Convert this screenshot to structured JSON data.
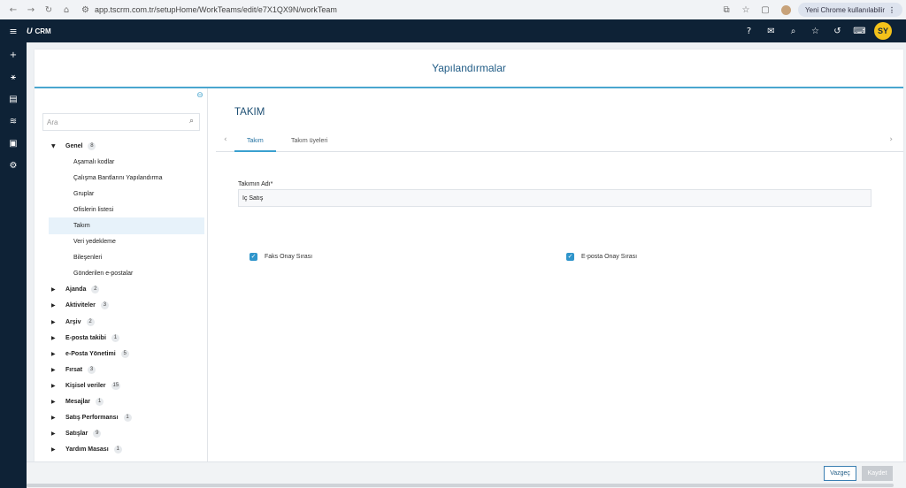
{
  "browser": {
    "url": "app.tscrm.com.tr/setupHome/WorkTeams/edit/e7X1QX9N/workTeam",
    "back_icon": "←",
    "forward_icon": "→",
    "reload_icon": "↻",
    "home_icon": "⌂",
    "site_info_icon": "⚙",
    "install_icon": "⧉",
    "star_icon": "☆",
    "extension_icon": "▢",
    "chrome_label": "Yeni Chrome kullanılabilir",
    "chrome_menu": "⋮"
  },
  "app": {
    "logo_mark": "U",
    "logo_text": "CRM",
    "menu_icon": "≡",
    "user_initials": "SY",
    "header_icons": {
      "help": "?",
      "mail": "✉",
      "search": "⌕",
      "favorites": "☆",
      "history": "↺",
      "keyboard": "⌨"
    },
    "rail_icons": {
      "add": "+",
      "network": "⚹",
      "sales": "▤",
      "reports": "≋",
      "finance": "▣",
      "settings": "⚙"
    },
    "colors": {
      "header_bg": "#0e2236",
      "accent": "#2f95cb",
      "avatar": "#f3c21a"
    }
  },
  "page": {
    "title": "Yapılandırmalar"
  },
  "sidebar": {
    "collapse_icon": "⊖",
    "search_placeholder": "Ara",
    "search_icon": "⌕",
    "groups": [
      {
        "label": "Genel",
        "count": "8",
        "expanded": true,
        "children": [
          "Aşamalı kodlar",
          "Çalışma Bantlarını Yapılandırma",
          "Gruplar",
          "Ofislerin listesi",
          "Takım",
          "Veri yedekleme",
          "Bileşenleri",
          "Gönderilen e-postalar"
        ],
        "active_child": 4
      },
      {
        "label": "Ajanda",
        "count": "2"
      },
      {
        "label": "Aktiviteler",
        "count": "3"
      },
      {
        "label": "Arşiv",
        "count": "2"
      },
      {
        "label": "E-posta takibi",
        "count": "1"
      },
      {
        "label": "e-Posta Yönetimi",
        "count": "5"
      },
      {
        "label": "Fırsat",
        "count": "3"
      },
      {
        "label": "Kişisel veriler",
        "count": "15"
      },
      {
        "label": "Mesajlar",
        "count": "1"
      },
      {
        "label": "Satış Performansı",
        "count": "1"
      },
      {
        "label": "Satışlar",
        "count": "9"
      },
      {
        "label": "Yardım Masası",
        "count": "1"
      }
    ]
  },
  "content": {
    "section_title": "TAKIM",
    "tabs": [
      {
        "label": "Takım",
        "active": true
      },
      {
        "label": "Takım üyeleri",
        "active": false
      }
    ],
    "tab_left": "‹",
    "tab_right": "›",
    "team_name_label": "Takımın Adı*",
    "team_name_value": "İç Satış",
    "checkboxes": [
      {
        "label": "Faks Onay Sırası",
        "checked": true
      },
      {
        "label": "E-posta Onay Sırası",
        "checked": true
      }
    ],
    "check_mark": "✓"
  },
  "footer": {
    "cancel_label": "Vazgeç",
    "save_label": "Kaydet"
  }
}
